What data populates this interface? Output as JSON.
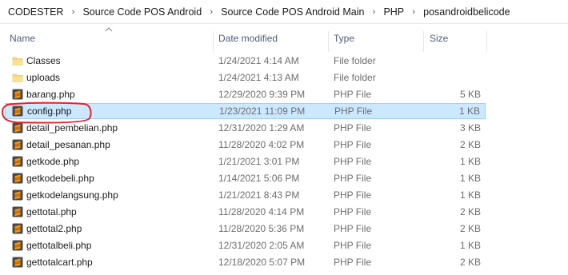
{
  "breadcrumb": {
    "items": [
      "CODESTER",
      "Source Code POS Android",
      "Source Code POS Android Main",
      "PHP",
      "posandroidbelicode"
    ],
    "separator": "›"
  },
  "columns": {
    "name": "Name",
    "date_modified": "Date modified",
    "type": "Type",
    "size": "Size"
  },
  "sort": {
    "column": "name",
    "indicator": "sort-ascending-icon"
  },
  "files": [
    {
      "name": "Classes",
      "date": "1/24/2021 4:14 AM",
      "type": "File folder",
      "size": "",
      "icon": "folder-icon",
      "selected": false
    },
    {
      "name": "uploads",
      "date": "1/24/2021 4:13 AM",
      "type": "File folder",
      "size": "",
      "icon": "folder-icon",
      "selected": false
    },
    {
      "name": "barang.php",
      "date": "12/29/2020 9:39 PM",
      "type": "PHP File",
      "size": "5 KB",
      "icon": "sublime-file-icon",
      "selected": false
    },
    {
      "name": "config.php",
      "date": "1/23/2021 11:09 PM",
      "type": "PHP File",
      "size": "1 KB",
      "icon": "sublime-file-icon",
      "selected": true
    },
    {
      "name": "detail_pembelian.php",
      "date": "12/31/2020 1:29 AM",
      "type": "PHP File",
      "size": "3 KB",
      "icon": "sublime-file-icon",
      "selected": false
    },
    {
      "name": "detail_pesanan.php",
      "date": "11/28/2020 4:02 PM",
      "type": "PHP File",
      "size": "2 KB",
      "icon": "sublime-file-icon",
      "selected": false
    },
    {
      "name": "getkode.php",
      "date": "1/21/2021 3:01 PM",
      "type": "PHP File",
      "size": "1 KB",
      "icon": "sublime-file-icon",
      "selected": false
    },
    {
      "name": "getkodebeli.php",
      "date": "1/14/2021 5:06 PM",
      "type": "PHP File",
      "size": "1 KB",
      "icon": "sublime-file-icon",
      "selected": false
    },
    {
      "name": "getkodelangsung.php",
      "date": "1/21/2021 8:43 PM",
      "type": "PHP File",
      "size": "1 KB",
      "icon": "sublime-file-icon",
      "selected": false
    },
    {
      "name": "gettotal.php",
      "date": "11/28/2020 4:14 PM",
      "type": "PHP File",
      "size": "2 KB",
      "icon": "sublime-file-icon",
      "selected": false
    },
    {
      "name": "gettotal2.php",
      "date": "11/28/2020 5:36 PM",
      "type": "PHP File",
      "size": "2 KB",
      "icon": "sublime-file-icon",
      "selected": false
    },
    {
      "name": "gettotalbeli.php",
      "date": "12/31/2020 2:05 AM",
      "type": "PHP File",
      "size": "1 KB",
      "icon": "sublime-file-icon",
      "selected": false
    },
    {
      "name": "gettotalcart.php",
      "date": "12/18/2020 5:07 PM",
      "type": "PHP File",
      "size": "2 KB",
      "icon": "sublime-file-icon",
      "selected": false
    }
  ],
  "colors": {
    "selection_bg": "#cce8ff",
    "selection_border": "#99d1ff",
    "annotation": "#e5242a",
    "folder": "#f8d775",
    "sublime_orange": "#ff9800",
    "sublime_bg": "#4a4a4a"
  }
}
